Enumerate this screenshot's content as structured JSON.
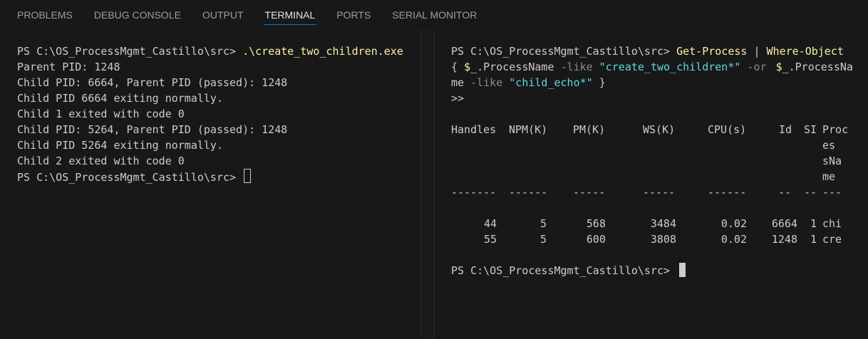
{
  "panel_tabs": [
    {
      "label": "PROBLEMS"
    },
    {
      "label": "DEBUG CONSOLE"
    },
    {
      "label": "OUTPUT"
    },
    {
      "label": "TERMINAL"
    },
    {
      "label": "PORTS"
    },
    {
      "label": "SERIAL MONITOR"
    }
  ],
  "active_tab": "TERMINAL",
  "left_terminal": {
    "prompt": "PS C:\\OS_ProcessMgmt_Castillo\\src> ",
    "command": ".\\create_two_children.exe",
    "output": [
      "Parent PID: 1248",
      "Child PID: 6664, Parent PID (passed): 1248",
      "Child PID 6664 exiting normally.",
      "Child 1 exited with code 0",
      "Child PID: 5264, Parent PID (passed): 1248",
      "Child PID 5264 exiting normally.",
      "Child 2 exited with code 0"
    ],
    "final_prompt": "PS C:\\OS_ProcessMgmt_Castillo\\src> "
  },
  "right_terminal": {
    "prompt": "PS C:\\OS_ProcessMgmt_Castillo\\src> ",
    "cmd1": "Get-Process",
    "pipe": " | ",
    "cmd2": "Where-Object",
    "l2_open": "{ ",
    "var1": "$_",
    "prop1": ".ProcessName ",
    "op1": "-like ",
    "str1": "\"create_two_children*\"",
    "op2": " -or ",
    "var2": "$_",
    "prop2a": ".ProcessNa",
    "prop2b": "me ",
    "op3": "-like ",
    "str2": "\"child_echo*\"",
    "close": " }",
    "continuation": ">>",
    "headers": [
      "Handles",
      "NPM(K)",
      "PM(K)",
      "WS(K)",
      "CPU(s)",
      "Id",
      "SI",
      "Proc",
      "es",
      "sNa",
      "me"
    ],
    "dashes": [
      "-------",
      "------",
      "-----",
      "-----",
      "------",
      "--",
      "--",
      "---"
    ],
    "rows": [
      {
        "handles": "44",
        "npm": "5",
        "pm": "568",
        "ws": "3484",
        "cpu": "0.02",
        "id": "6664",
        "si": "1",
        "name": "chi"
      },
      {
        "handles": "55",
        "npm": "5",
        "pm": "600",
        "ws": "3808",
        "cpu": "0.02",
        "id": "1248",
        "si": "1",
        "name": "cre"
      }
    ],
    "final_prompt": "PS C:\\OS_ProcessMgmt_Castillo\\src> "
  }
}
